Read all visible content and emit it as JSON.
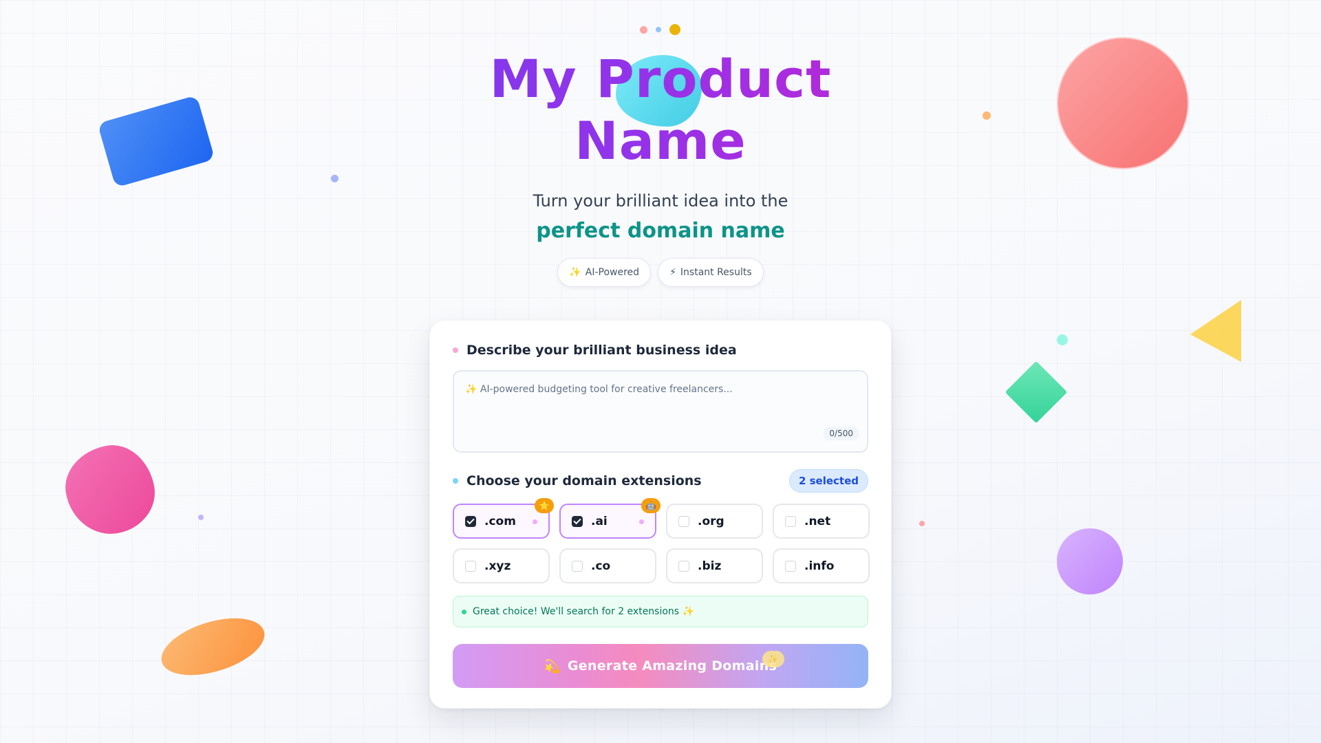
{
  "hero": {
    "title_line1": "My Product",
    "title_line2": "Name",
    "subtitle": "Turn your brilliant idea into the",
    "highlight": "perfect domain name",
    "badges": [
      {
        "icon": "✨",
        "label": "AI-Powered"
      },
      {
        "icon": "⚡",
        "label": "Instant Results"
      }
    ]
  },
  "form": {
    "idea_label": "Describe your brilliant business idea",
    "idea_placeholder": "✨ AI-powered budgeting tool for creative freelancers...",
    "idea_value": "",
    "char_counter": "0/500",
    "extensions_label": "Choose your domain extensions",
    "selected_count": "2 selected",
    "extensions": [
      {
        "label": ".com",
        "checked": true,
        "badge": "⭐"
      },
      {
        "label": ".ai",
        "checked": true,
        "badge": "🤖"
      },
      {
        "label": ".org",
        "checked": false
      },
      {
        "label": ".net",
        "checked": false
      },
      {
        "label": ".xyz",
        "checked": false
      },
      {
        "label": ".co",
        "checked": false
      },
      {
        "label": ".biz",
        "checked": false
      },
      {
        "label": ".info",
        "checked": false
      }
    ],
    "notice": "Great choice! We'll search for 2 extensions ✨",
    "generate_icon": "💫",
    "generate_label": "Generate Amazing Domains",
    "generate_spark": "✨"
  },
  "colors": {
    "title_gradient": [
      "#7c3aed",
      "#c026d3"
    ],
    "highlight": "#0d9488",
    "accent_pink": "#f0abfc",
    "success": "#047857"
  }
}
